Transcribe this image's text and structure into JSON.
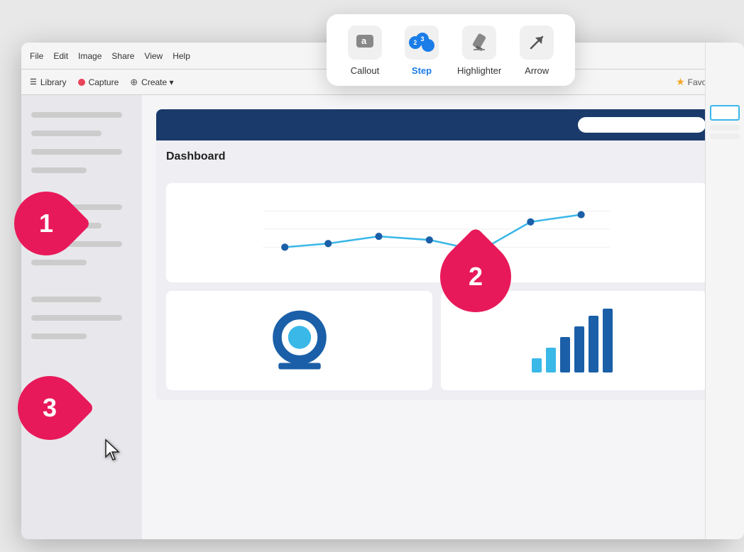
{
  "toolbar_popup": {
    "tools": [
      {
        "id": "callout",
        "label": "Callout",
        "icon": "callout",
        "active": false
      },
      {
        "id": "step",
        "label": "Step",
        "icon": "step",
        "active": true
      },
      {
        "id": "highlighter",
        "label": "Highlighter",
        "icon": "highlighter",
        "active": false
      },
      {
        "id": "arrow",
        "label": "Arrow",
        "icon": "arrow",
        "active": false
      }
    ]
  },
  "title_bar": {
    "menu_items": [
      "File",
      "Edit",
      "Image",
      "Share",
      "View",
      "Help"
    ]
  },
  "toolbar": {
    "items": [
      "Library",
      "Capture",
      "Create ▾"
    ],
    "favorites": "Favorites"
  },
  "dashboard": {
    "title": "Dashboard",
    "search_placeholder": ""
  },
  "steps": [
    {
      "number": "1"
    },
    {
      "number": "2"
    },
    {
      "number": "3"
    }
  ]
}
